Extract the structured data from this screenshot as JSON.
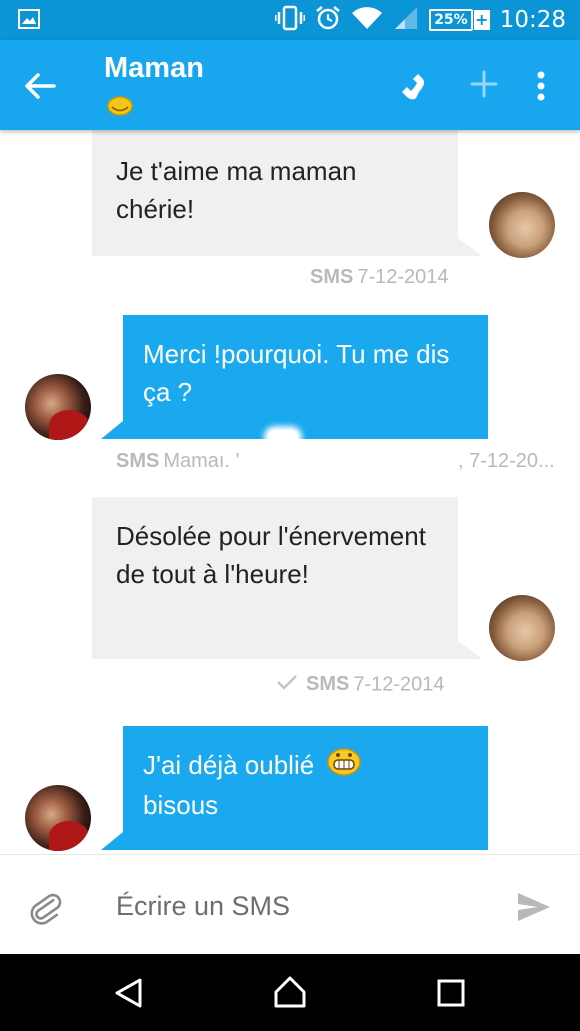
{
  "status_bar": {
    "battery": "25%",
    "battery_plus": "+",
    "time": "10:28"
  },
  "header": {
    "contact_name": "Maman",
    "icons": [
      "back-arrow-icon",
      "phone-icon",
      "add-icon",
      "more-vert-icon"
    ]
  },
  "messages": [
    {
      "direction": "incoming",
      "text": "Je t'aime ma maman chérie!",
      "tag": "SMS",
      "meta": "7-12-2014",
      "read_check": false
    },
    {
      "direction": "outgoing",
      "text": "Merci !pourquoi. Tu me dis ça ?",
      "tag": "SMS",
      "meta_left": "Mamaı. '",
      "meta_right": ", 7-12-20..."
    },
    {
      "direction": "incoming",
      "text": "Désolée pour l'énervement de tout à l'heure!",
      "tag": "SMS",
      "meta": "7-12-2014",
      "read_check": true
    },
    {
      "direction": "outgoing",
      "text_line1": "J'ai déjà oublié",
      "text_line2": "bisous"
    }
  ],
  "compose": {
    "placeholder": "Écrire un SMS"
  },
  "colors": {
    "status_bar": "#0b95d6",
    "app_bar": "#18a7ee",
    "outgoing_bubble": "#1aa9ee",
    "incoming_bubble": "#f0f0f0",
    "meta_text": "#b9b9b9"
  }
}
